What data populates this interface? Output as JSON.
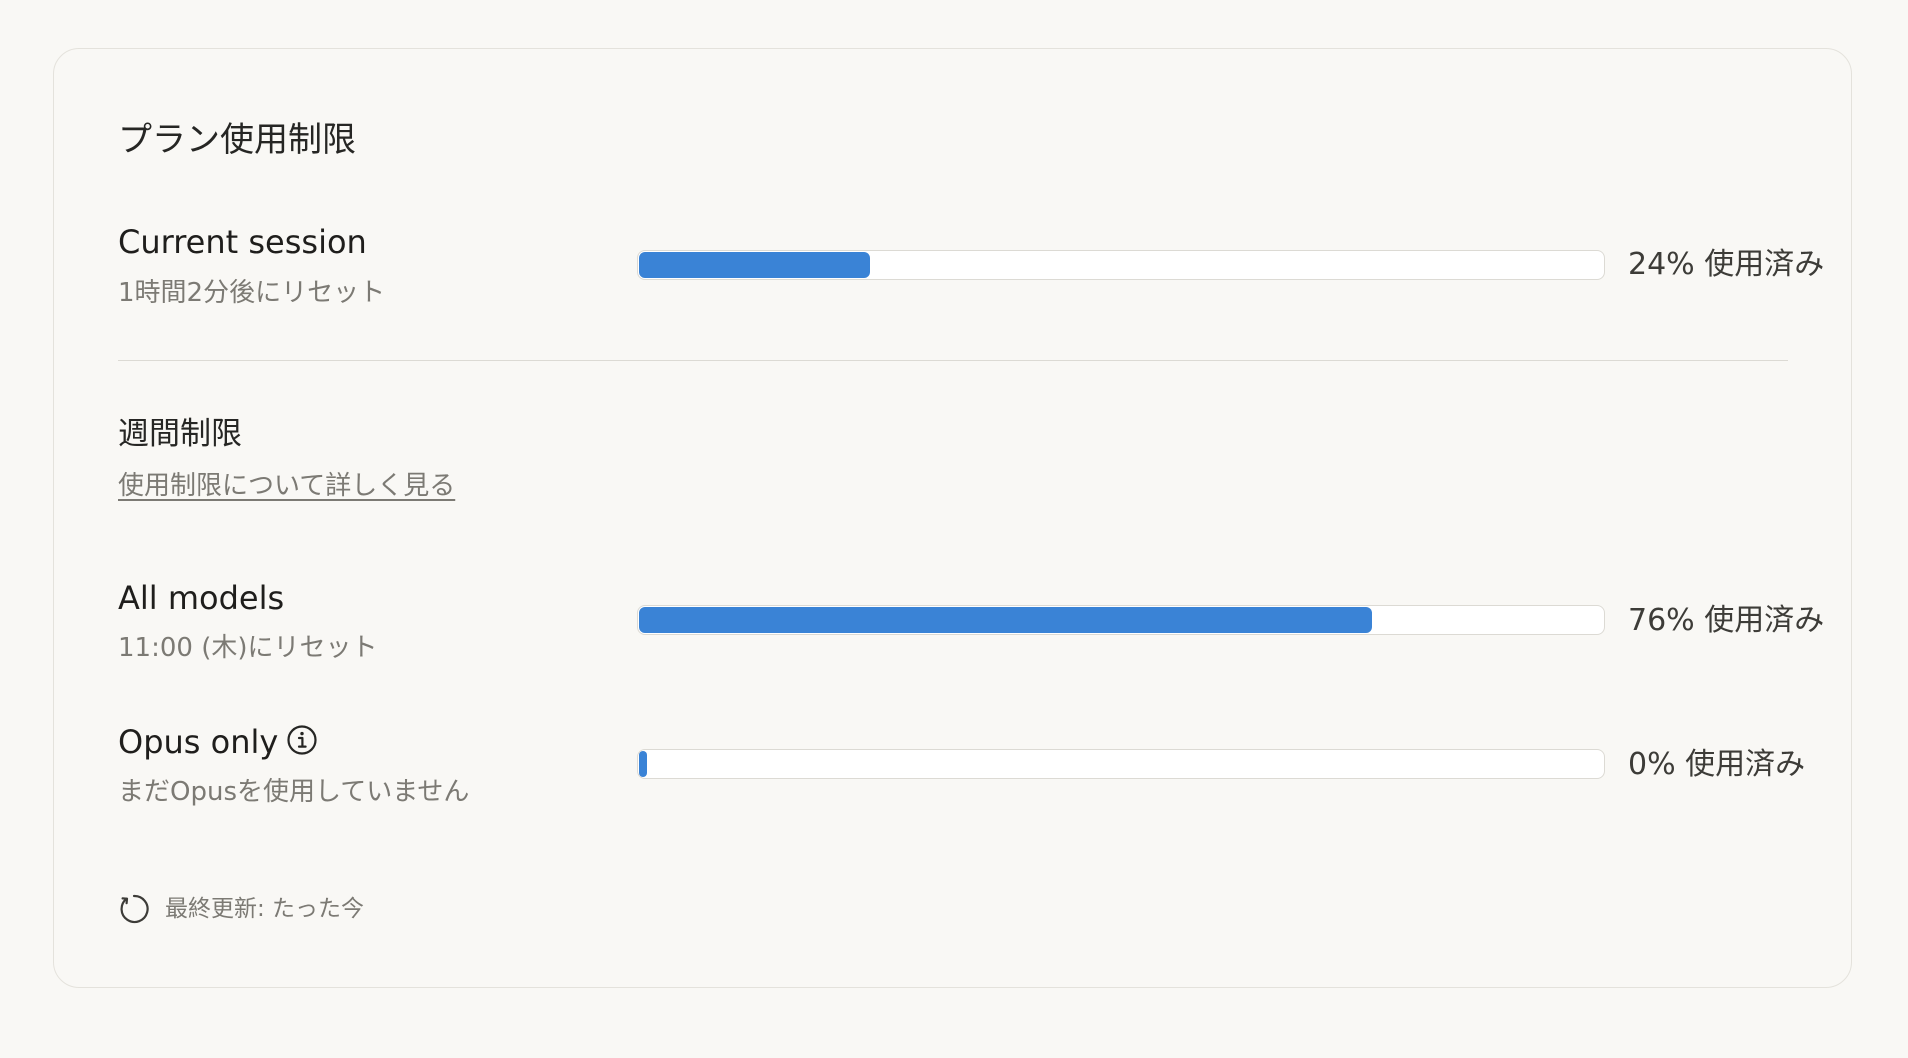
{
  "title": "プラン使用制限",
  "current_session": {
    "label": "Current session",
    "reset": "1時間2分後にリセット",
    "percent_text": "24% 使用済み",
    "usage_fraction": 0.24,
    "bar_color": "#3a83d6"
  },
  "weekly": {
    "title": "週間制限",
    "learn_more": "使用制限について詳しく見る"
  },
  "all_models": {
    "label": "All models",
    "reset": "11:00 (木)にリセット",
    "percent_text": "76% 使用済み",
    "usage_fraction": 0.76,
    "bar_color": "#3a83d6"
  },
  "opus_only": {
    "label": "Opus only",
    "info_icon": "info-icon",
    "status": "まだOpusを使用していません",
    "percent_text": "0% 使用済み",
    "usage_fraction": 0.0,
    "bar_color": "#3a83d6"
  },
  "footer": {
    "icon": "refresh-icon",
    "last_updated": "最終更新: たった今"
  }
}
